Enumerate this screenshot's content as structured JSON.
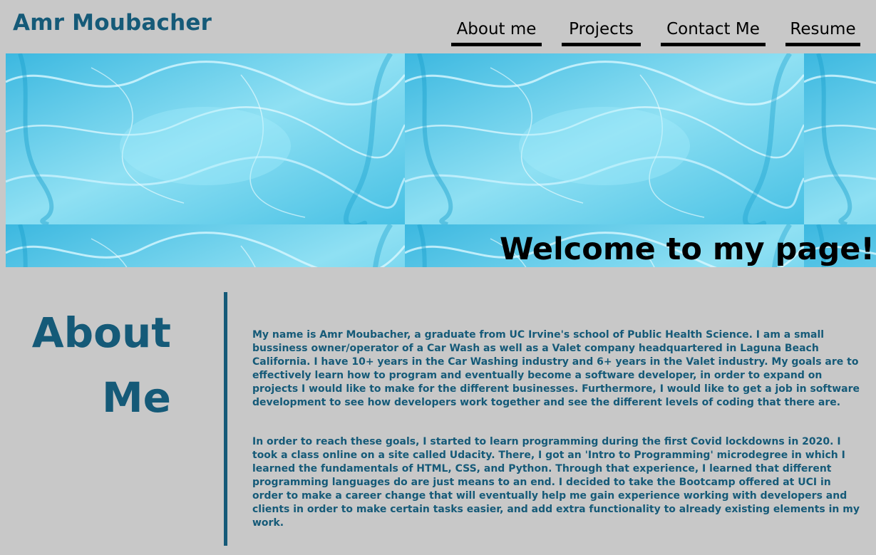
{
  "header": {
    "site_title": "Amr Moubacher"
  },
  "nav": {
    "items": [
      {
        "label": "About me"
      },
      {
        "label": "Projects"
      },
      {
        "label": "Contact Me"
      },
      {
        "label": "Resume"
      }
    ]
  },
  "hero": {
    "tagline": "Welcome to my page!",
    "image": "water-ripples-tiled-background"
  },
  "about": {
    "heading_line1": "About",
    "heading_line2": "Me",
    "paragraphs": [
      "My name is Amr Moubacher, a graduate from UC Irvine's school of Public Health Science. I am a small bussiness owner/operator of a Car Wash as well as a Valet company headquartered in Laguna Beach California. I have 10+ years in the Car Washing industry and 6+ years in the Valet industry. My goals are to effectively learn how to program and eventually become a software developer, in order to expand on projects I would like to make for the different businesses. Furthermore, I would like to get a job in software development to see how developers work together and see the different levels of coding that there are.",
      "In order to reach these goals, I started to learn programming during the first Covid lockdowns in 2020. I took a class online on a site called Udacity. There, I got an 'Intro to Programming' microdegree in which I learned the fundamentals of HTML, CSS, and Python. Through that experience, I learned that different programming languages do are just means to an end. I decided to take the Bootcamp offered at UCI in order to make a career change that will eventually help me gain experience working with developers and clients in order to make certain tasks easier, and add extra functionality to already existing elements in my work."
    ]
  },
  "colors": {
    "page_background": "#c8c8c8",
    "accent": "#155a78",
    "nav_underline": "#000000"
  }
}
